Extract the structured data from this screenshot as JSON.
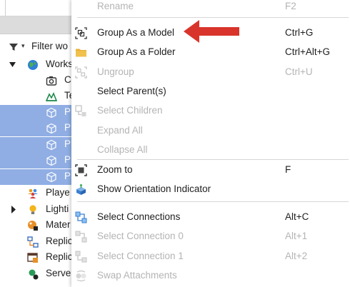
{
  "explorer": {
    "filter_placeholder": "Filter wo",
    "tree": [
      {
        "label": "Works",
        "icon": "workspace-globe-icon",
        "expanded": true,
        "selected": false
      },
      {
        "label": "C",
        "icon": "camera-icon",
        "selected": false
      },
      {
        "label": "Te",
        "icon": "terrain-icon",
        "selected": false
      },
      {
        "label": "P",
        "icon": "part-icon",
        "selected": true
      },
      {
        "label": "P",
        "icon": "part-icon",
        "selected": true
      },
      {
        "label": "P",
        "icon": "part-icon",
        "selected": true
      },
      {
        "label": "P",
        "icon": "part-icon",
        "selected": true
      },
      {
        "label": "P",
        "icon": "part-icon",
        "selected": true
      },
      {
        "label": "Playe",
        "icon": "players-icon",
        "selected": false
      },
      {
        "label": "Lighti",
        "icon": "lighting-icon",
        "collapsed_arrow": true,
        "selected": false
      },
      {
        "label": "Mater",
        "icon": "material-service-icon",
        "selected": false
      },
      {
        "label": "Replic",
        "icon": "replicated-first-icon",
        "selected": false
      },
      {
        "label": "Replic",
        "icon": "replicated-storage-icon",
        "selected": false
      },
      {
        "label": "Serve",
        "icon": "server-script-service-icon",
        "selected": false
      }
    ]
  },
  "menu": {
    "items": [
      {
        "label": "Rename",
        "shortcut": "F2",
        "disabled": true,
        "icon": ""
      },
      {
        "label": "Group As a Model",
        "shortcut": "Ctrl+G",
        "disabled": false,
        "icon": "group-model-icon"
      },
      {
        "label": "Group As a Folder",
        "shortcut": "Ctrl+Alt+G",
        "disabled": false,
        "icon": "folder-icon"
      },
      {
        "label": "Ungroup",
        "shortcut": "Ctrl+U",
        "disabled": true,
        "icon": "ungroup-icon"
      },
      {
        "label": "Select Parent(s)",
        "shortcut": "",
        "disabled": false,
        "icon": ""
      },
      {
        "label": "Select Children",
        "shortcut": "",
        "disabled": true,
        "icon": "select-children-icon"
      },
      {
        "label": "Expand All",
        "shortcut": "",
        "disabled": true,
        "icon": ""
      },
      {
        "label": "Collapse All",
        "shortcut": "",
        "disabled": true,
        "icon": ""
      },
      {
        "label": "Zoom to",
        "shortcut": "F",
        "disabled": false,
        "icon": "zoom-to-icon"
      },
      {
        "label": "Show Orientation Indicator",
        "shortcut": "",
        "disabled": false,
        "icon": "orientation-indicator-icon"
      },
      {
        "label": "Select Connections",
        "shortcut": "Alt+C",
        "disabled": false,
        "icon": "select-connections-icon"
      },
      {
        "label": "Select Connection 0",
        "shortcut": "Alt+1",
        "disabled": true,
        "icon": "select-connection-icon"
      },
      {
        "label": "Select Connection 1",
        "shortcut": "Alt+2",
        "disabled": true,
        "icon": "select-connection-icon"
      },
      {
        "label": "Swap Attachments",
        "shortcut": "",
        "disabled": true,
        "icon": "swap-attachments-icon"
      }
    ]
  },
  "colors": {
    "selection": "#90aee4",
    "disabled_text": "#b4b4b4",
    "annotation_arrow": "#d9342b"
  }
}
